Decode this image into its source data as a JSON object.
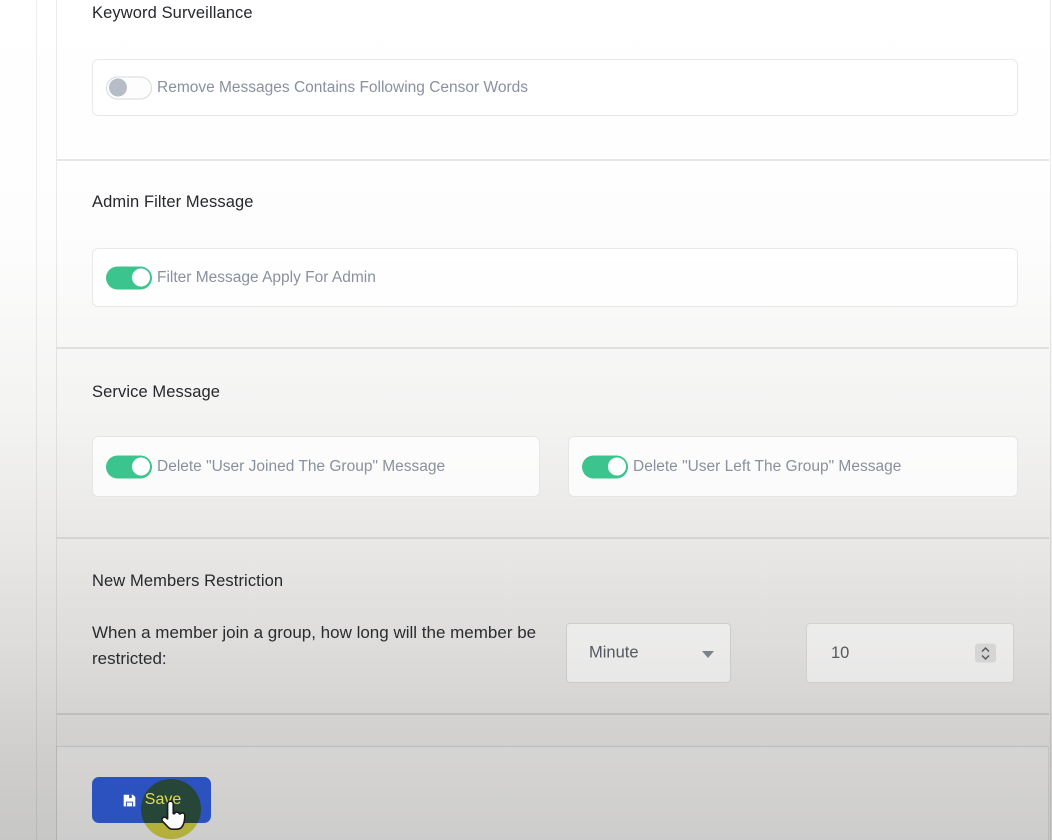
{
  "sections": [
    {
      "title": "Keyword Surveillance",
      "toggles": [
        {
          "label": "Remove Messages Contains Following Censor Words",
          "state": "off"
        }
      ]
    },
    {
      "title": "Admin Filter Message",
      "toggles": [
        {
          "label": "Filter Message Apply For Admin",
          "state": "on"
        }
      ]
    },
    {
      "title": "Service Message",
      "toggles": [
        {
          "label": "Delete \"User Joined The Group\" Message",
          "state": "on"
        },
        {
          "label": "Delete \"User Left The Group\" Message",
          "state": "on"
        }
      ]
    },
    {
      "title": "New Members Restriction",
      "description": "When a member join a group, how long will the member be restricted:",
      "unit_select": {
        "value": "Minute"
      },
      "duration_input": {
        "value": "10"
      }
    }
  ],
  "save": {
    "label": "Save",
    "icon": "floppy-disk-icon"
  },
  "cursor": {
    "type": "pointer-hand-with-click-highlight"
  },
  "colors": {
    "toggle_on": "#3bc48e",
    "toggle_off_knob": "#b7bdc7",
    "save_button_bg": "#2b52bf",
    "click_highlight": "#dfda4a",
    "label_text": "#8a90a0",
    "heading_text": "#26282c"
  }
}
